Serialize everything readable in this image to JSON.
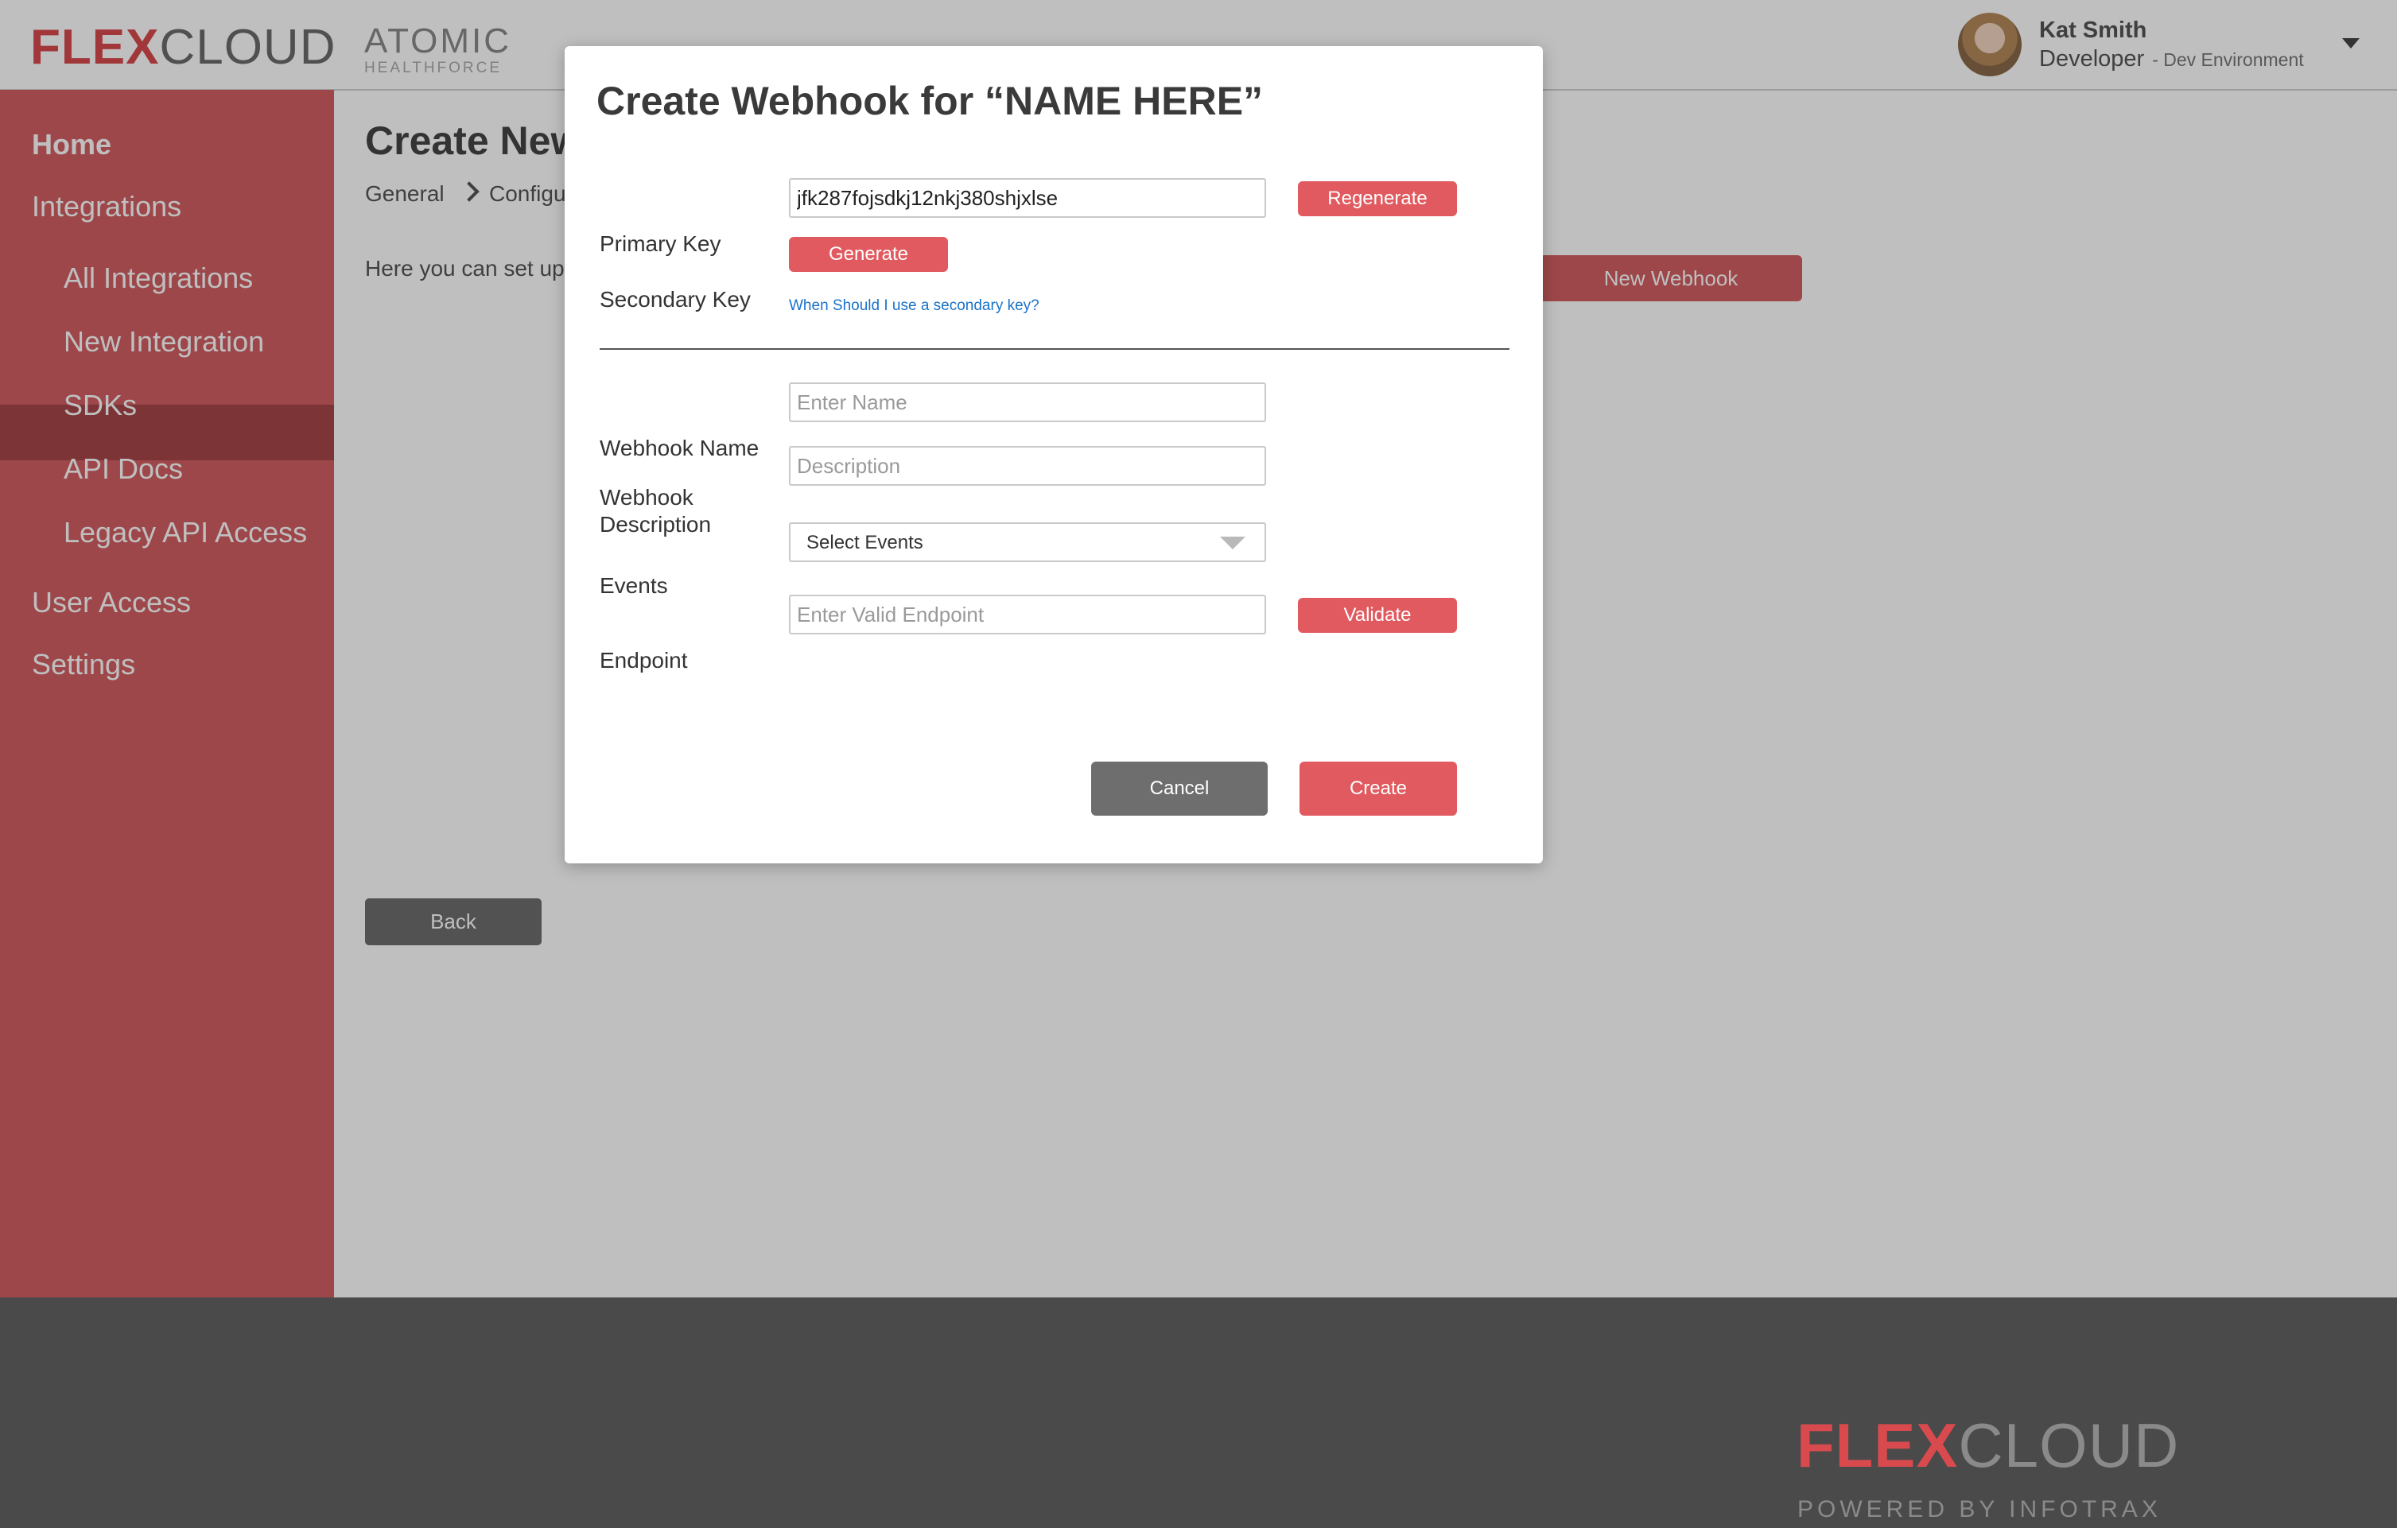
{
  "header": {
    "logo_flex": "FLEX",
    "logo_cloud": "CLOUD",
    "partner_top": "ATOMIC",
    "partner_bottom": "HEALTHFORCE",
    "user_name": "Kat Smith",
    "user_role": "Developer",
    "user_env": "- Dev Environment"
  },
  "sidebar": {
    "home": "Home",
    "integrations": "Integrations",
    "all_integrations": "All Integrations",
    "new_integration": "New Integration",
    "sdks": "SDKs",
    "api_docs": "API Docs",
    "legacy_api_access": "Legacy API Access",
    "user_access": "User Access",
    "settings": "Settings"
  },
  "main": {
    "title": "Create New",
    "breadcrumb": [
      "General",
      "Configu"
    ],
    "intro": "Here you can set up c",
    "new_webhook_label": "New Webhook",
    "back_label": "Back"
  },
  "modal": {
    "title": "Create Webhook for “NAME HERE”",
    "primary_key_label": "Primary Key",
    "primary_key_value": "jfk287fojsdkj12nkj380shjxlse",
    "regenerate_label": "Regenerate",
    "secondary_key_label": "Secondary Key",
    "generate_label": "Generate",
    "secondary_help_link": "When Should I use a secondary key?",
    "webhook_name_label": "Webhook Name",
    "webhook_name_placeholder": "Enter Name",
    "webhook_description_label_1": "Webhook",
    "webhook_description_label_2": "Description",
    "webhook_description_placeholder": "Description",
    "events_label": "Events",
    "events_selected": "Select Events",
    "endpoint_label": "Endpoint",
    "endpoint_placeholder": "Enter Valid Endpoint",
    "validate_label": "Validate",
    "cancel_label": "Cancel",
    "create_label": "Create"
  },
  "footer": {
    "logo_flex": "FLEX",
    "logo_cloud": "CLOUD",
    "tagline": "POWERED BY INFOTRAX"
  },
  "colors": {
    "brand_red": "#d84a4e",
    "sidebar": "#d35f63",
    "sidebar_active": "#a64649",
    "button_red": "#e05a5f",
    "button_gray": "#6e6e6e",
    "footer": "#4a4a4a",
    "link": "#1a73c9"
  }
}
